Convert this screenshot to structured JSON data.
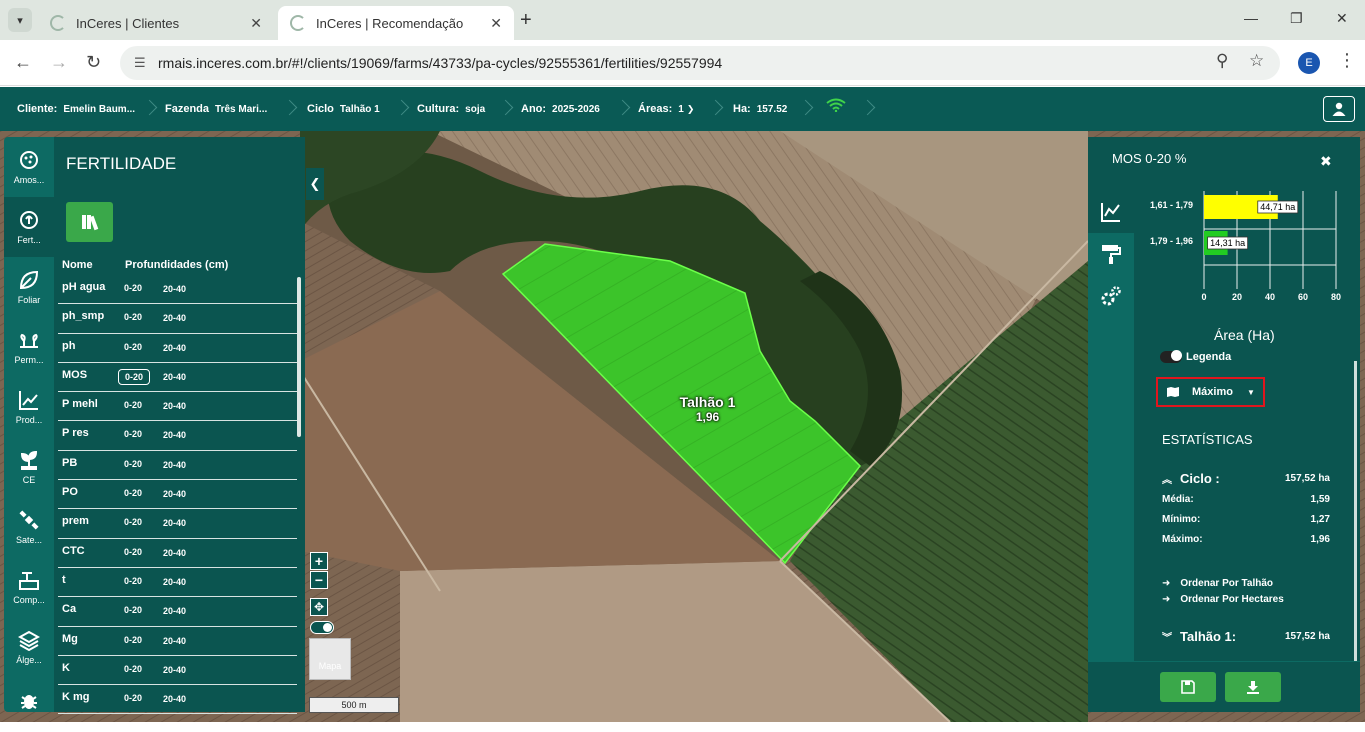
{
  "browser": {
    "tabs": [
      {
        "title": "InCeres | Clientes",
        "active": false
      },
      {
        "title": "InCeres | Recomendação",
        "active": true
      }
    ],
    "url": "rmais.inceres.com.br/#!/clients/19069/farms/43733/pa-cycles/92555361/fertilities/92557994",
    "profile_initial": "E"
  },
  "header": {
    "cliente": {
      "label": "Cliente:",
      "value": "Emelin Baum..."
    },
    "fazenda": {
      "label": "Fazenda",
      "value": "Três Mari..."
    },
    "ciclo": {
      "label": "Ciclo",
      "value": "Talhão 1"
    },
    "cultura": {
      "label": "Cultura:",
      "value": "soja"
    },
    "ano": {
      "label": "Ano:",
      "value": "2025-2026"
    },
    "areas": {
      "label": "Áreas:",
      "value": "1"
    },
    "ha": {
      "label": "Ha:",
      "value": "157.52"
    }
  },
  "icon_bar": [
    {
      "label": "Amos...",
      "icon": "sampling-icon"
    },
    {
      "label": "Fert...",
      "icon": "fertility-icon",
      "active": true
    },
    {
      "label": "Foliar",
      "icon": "leaf-icon"
    },
    {
      "label": "Perm...",
      "icon": "plants-icon"
    },
    {
      "label": "Prod...",
      "icon": "productivity-chart-icon"
    },
    {
      "label": "CE",
      "icon": "sprout-icon"
    },
    {
      "label": "Sate...",
      "icon": "satellite-icon"
    },
    {
      "label": "Comp...",
      "icon": "compaction-icon"
    },
    {
      "label": "Álge...",
      "icon": "layers-icon"
    },
    {
      "label": "",
      "icon": "bug-icon"
    }
  ],
  "fertility": {
    "title": "FERTILIDADE",
    "col_name": "Nome",
    "col_depths": "Profundidades (cm)",
    "rows": [
      {
        "name": "pH agua",
        "d1": "0-20",
        "d2": "20-40"
      },
      {
        "name": "ph_smp",
        "d1": "0-20",
        "d2": "20-40"
      },
      {
        "name": "ph",
        "d1": "0-20",
        "d2": "20-40"
      },
      {
        "name": "MOS",
        "d1": "0-20",
        "d2": "20-40",
        "selected": true
      },
      {
        "name": "P mehl",
        "d1": "0-20",
        "d2": "20-40"
      },
      {
        "name": "P res",
        "d1": "0-20",
        "d2": "20-40"
      },
      {
        "name": "PB",
        "d1": "0-20",
        "d2": "20-40"
      },
      {
        "name": "PO",
        "d1": "0-20",
        "d2": "20-40"
      },
      {
        "name": "prem",
        "d1": "0-20",
        "d2": "20-40"
      },
      {
        "name": "CTC",
        "d1": "0-20",
        "d2": "20-40"
      },
      {
        "name": "t",
        "d1": "0-20",
        "d2": "20-40"
      },
      {
        "name": "Ca",
        "d1": "0-20",
        "d2": "20-40"
      },
      {
        "name": "Mg",
        "d1": "0-20",
        "d2": "20-40"
      },
      {
        "name": "K",
        "d1": "0-20",
        "d2": "20-40"
      },
      {
        "name": "K mg",
        "d1": "0-20",
        "d2": "20-40"
      }
    ]
  },
  "map": {
    "field_name": "Talhão 1",
    "field_value": "1,96",
    "map_thumb_label": "Mapa",
    "scale_label": "500 m"
  },
  "right_panel": {
    "title": "MOS 0-20 %",
    "area_label": "Área (Ha)",
    "legend_label": "Legenda",
    "select_value": "Máximo",
    "stats_title": "ESTATÍSTICAS",
    "cycle_label": "Ciclo",
    "cycle_value": "157,52 ha",
    "media_label": "Média:",
    "media_value": "1,59",
    "min_label": "Mínimo:",
    "min_value": "1,27",
    "max_label": "Máximo:",
    "max_value": "1,96",
    "order_talhao": "Ordenar Por Talhão",
    "order_hectares": "Ordenar Por Hectares",
    "talhao_label": "Talhão 1:",
    "talhao_value": "157,52 ha"
  },
  "chart_data": {
    "type": "bar",
    "orientation": "horizontal",
    "categories": [
      "1,61 - 1,79",
      "1,79 - 1,96"
    ],
    "values": [
      44.71,
      14.31
    ],
    "data_labels": [
      "44,71 ha",
      "14,31 ha"
    ],
    "colors": [
      "#ffff00",
      "#22cc22"
    ],
    "x_ticks": [
      "0",
      "20",
      "40",
      "60",
      "80"
    ],
    "xlim": [
      0,
      80
    ],
    "xlabel": "Área (Ha)"
  },
  "colors": {
    "header": "#0a5a55",
    "panel": "#0b5550",
    "accent_green": "#3aa84a",
    "highlight_red": "#e0151d"
  }
}
